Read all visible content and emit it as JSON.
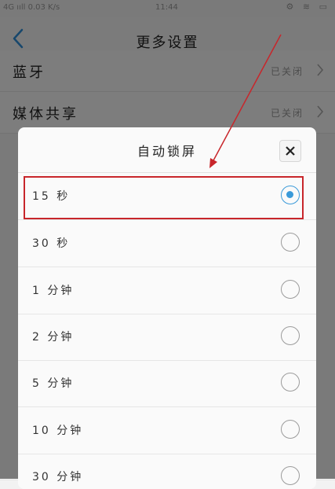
{
  "status_bar": {
    "left": "4G ııll 0.03 K/s",
    "time": "11:44",
    "right": "⚙ ≋ ▭"
  },
  "nav": {
    "title": "更多设置",
    "back_icon": "chevron-left-icon"
  },
  "background_settings": [
    {
      "label": "蓝牙",
      "value": "已关闭"
    },
    {
      "label": "媒体共享",
      "value": "已关闭"
    }
  ],
  "dialog": {
    "title": "自动锁屏",
    "close_icon": "close-icon",
    "options": [
      {
        "label": "15 秒",
        "selected": true
      },
      {
        "label": "30 秒",
        "selected": false
      },
      {
        "label": "1 分钟",
        "selected": false
      },
      {
        "label": "2 分钟",
        "selected": false
      },
      {
        "label": "5 分钟",
        "selected": false
      },
      {
        "label": "10 分钟",
        "selected": false
      },
      {
        "label": "30 分钟",
        "selected": false
      }
    ]
  },
  "colors": {
    "accent": "#3a9ad9",
    "annotation": "#c8262b"
  }
}
